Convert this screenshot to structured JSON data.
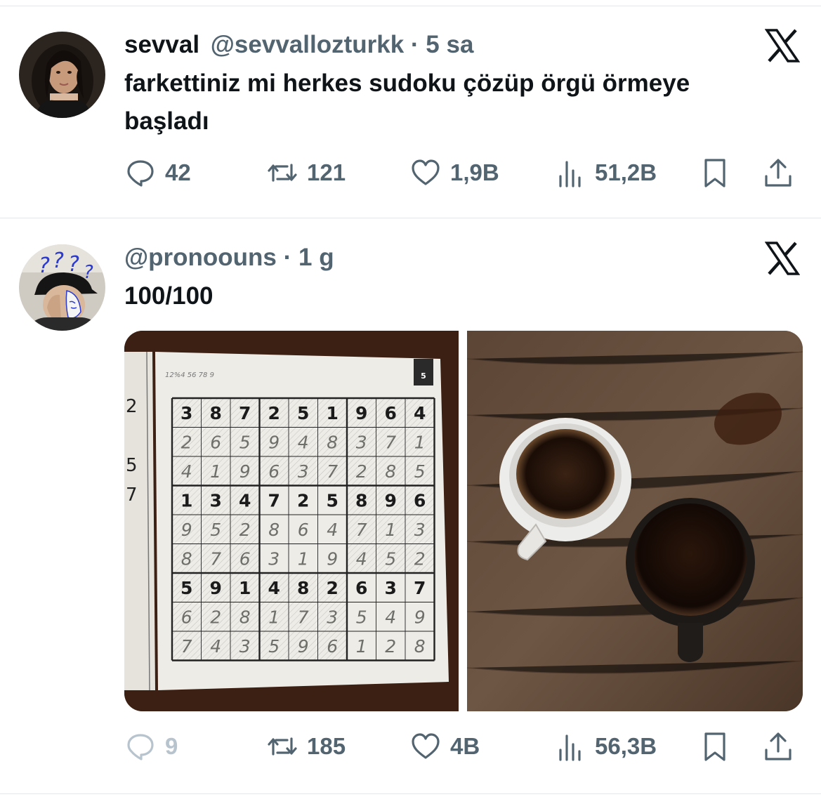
{
  "tweets": [
    {
      "display_name": "sevval",
      "handle": "@sevvallozturkk",
      "separator": "·",
      "time": "5 sa",
      "text": "farkettiniz mi herkes sudoku çözüp örgü örmeye başladı",
      "stats": {
        "replies": "42",
        "reposts": "121",
        "likes": "1,9B",
        "views": "51,2B"
      },
      "avatar_icon": "profile-photo-woman"
    },
    {
      "display_name": "",
      "handle": "@pronoouns",
      "separator": "·",
      "time": "1 g",
      "text": "100/100",
      "stats": {
        "replies": "9",
        "reposts": "185",
        "likes": "4B",
        "views": "56,3B"
      },
      "avatar_icon": "profile-photo-cap-question-marks",
      "media": {
        "left_image": "sudoku-puzzle-photo",
        "right_image": "coffee-cups-photo",
        "sudoku": {
          "page_number": "5",
          "header_scribble": "12%4 56 78 9",
          "grid": [
            [
              "3",
              "8",
              "7",
              "2",
              "5",
              "1",
              "9",
              "6",
              "4"
            ],
            [
              "2",
              "6",
              "5",
              "9",
              "4",
              "8",
              "3",
              "7",
              "1"
            ],
            [
              "4",
              "1",
              "9",
              "6",
              "3",
              "7",
              "2",
              "8",
              "5"
            ],
            [
              "1",
              "3",
              "4",
              "7",
              "2",
              "5",
              "8",
              "9",
              "6"
            ],
            [
              "9",
              "5",
              "2",
              "8",
              "6",
              "4",
              "7",
              "1",
              "3"
            ],
            [
              "8",
              "7",
              "6",
              "3",
              "1",
              "9",
              "4",
              "5",
              "2"
            ],
            [
              "5",
              "9",
              "1",
              "4",
              "8",
              "2",
              "6",
              "3",
              "7"
            ],
            [
              "6",
              "2",
              "8",
              "1",
              "7",
              "3",
              "5",
              "4",
              "9"
            ],
            [
              "7",
              "4",
              "3",
              "5",
              "9",
              "6",
              "1",
              "2",
              "8"
            ]
          ],
          "side_numbers": [
            "2",
            "5",
            "7"
          ]
        }
      }
    }
  ],
  "icons": {
    "platform_logo": "x-logo-icon",
    "reply": "reply-icon",
    "repost": "repost-icon",
    "like": "heart-icon",
    "views": "views-icon",
    "bookmark": "bookmark-icon",
    "share": "share-icon"
  },
  "colors": {
    "text_primary": "#0f1419",
    "text_secondary": "#536471",
    "text_disabled": "#b7c3cd",
    "divider": "#e3e6ea"
  }
}
